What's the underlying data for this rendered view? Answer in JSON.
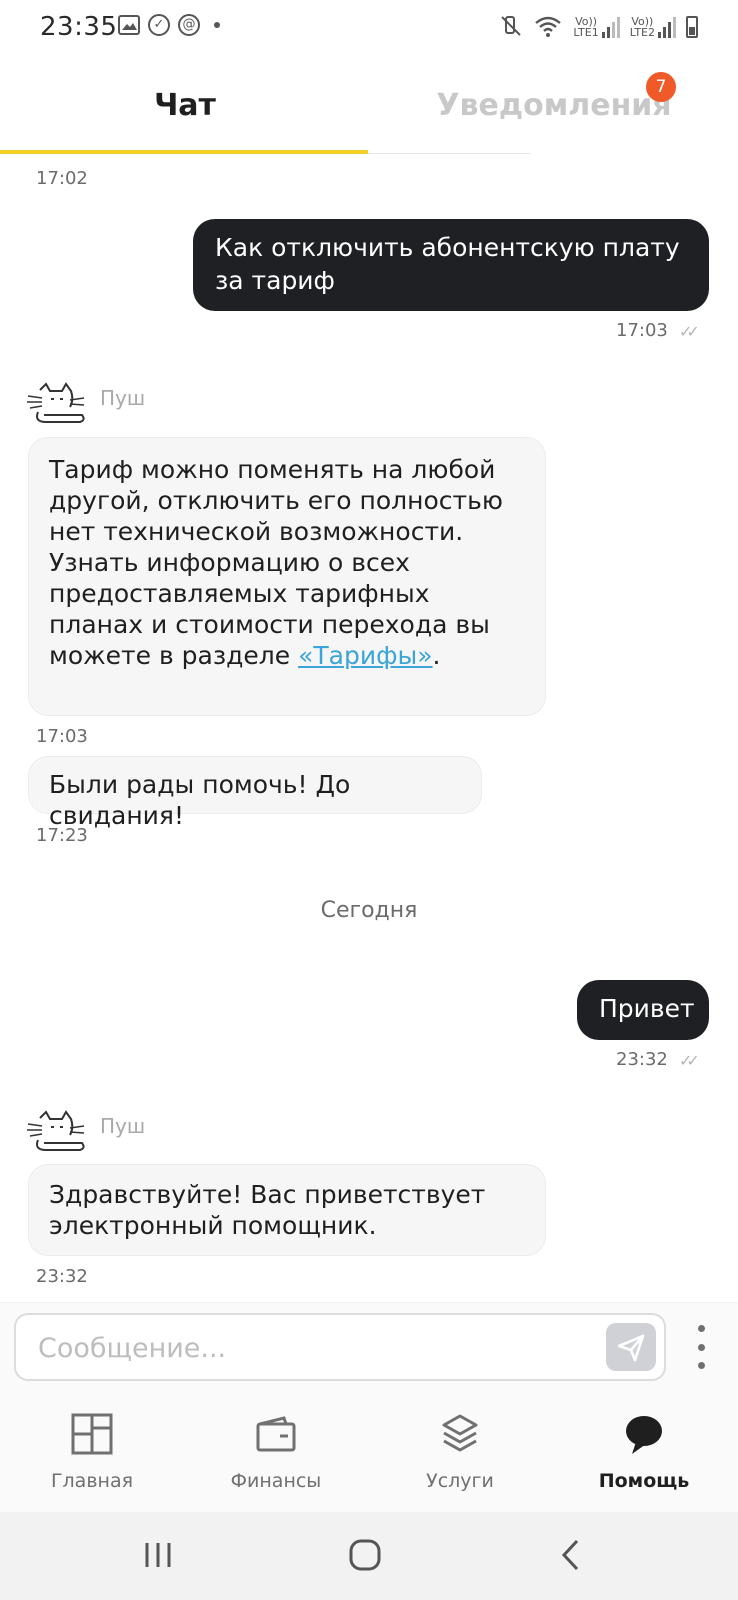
{
  "status_bar": {
    "time": "23:35",
    "left_icons": [
      "image-icon",
      "check-circle-icon",
      "at-icon",
      "dot-icon"
    ],
    "right_icons": [
      "mute-vibrate-icon",
      "wifi-icon",
      "signal-sim1-icon",
      "signal-sim2-icon",
      "battery-icon"
    ],
    "sim1_label_top": "Vo))",
    "sim1_label_bottom": "LTE1",
    "sim2_label_top": "Vo))",
    "sim2_label_bottom": "LTE2"
  },
  "tabs": {
    "chat": "Чат",
    "notifications": "Уведомления",
    "notifications_badge": "7",
    "active": "chat",
    "accent_color": "#f2cf25",
    "badge_color": "#f05a28"
  },
  "messages": {
    "m0_time": "17:02",
    "m1": {
      "text": "Как отключить абонентскую плату за тариф",
      "time": "17:03",
      "status_icon": "double-check-icon"
    },
    "bot_name": "Пуш",
    "m2": {
      "text_before_link": "Тариф можно поменять на любой другой, отключить его полностью нет технической возможности. Узнать информацию о всех предоставляемых тарифных планах и стоимости перехода вы можете в разделе ",
      "link_text": "«Тарифы»",
      "text_after_link": ".",
      "time": "17:03"
    },
    "m3": {
      "text": "Были рады помочь! До свидания!",
      "time": "17:23"
    },
    "day_separator": "Сегодня",
    "m4": {
      "text": "Привет",
      "time": "23:32",
      "status_icon": "double-check-icon"
    },
    "bot_name_2": "Пуш",
    "m5": {
      "text": "Здравствуйте! Вас приветствует электронный помощник.",
      "time": "23:32"
    }
  },
  "input": {
    "placeholder": "Сообщение...",
    "value": ""
  },
  "bottom_nav": {
    "items": [
      {
        "label": "Главная",
        "icon": "dashboard-icon"
      },
      {
        "label": "Финансы",
        "icon": "wallet-icon"
      },
      {
        "label": "Услуги",
        "icon": "layers-icon"
      },
      {
        "label": "Помощь",
        "icon": "chat-bubble-icon"
      }
    ],
    "active_index": 3
  },
  "system_nav": [
    "recent-apps-icon",
    "home-icon",
    "back-icon"
  ]
}
